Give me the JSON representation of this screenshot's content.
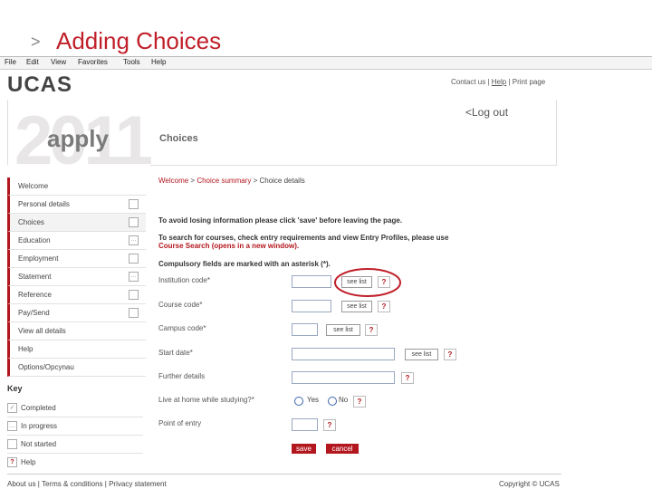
{
  "slide": {
    "arrow": ">",
    "title": "Adding Choices"
  },
  "menubar": [
    "File",
    "Edit",
    "View",
    "Favorites",
    "Tools",
    "Help"
  ],
  "header": {
    "logo": "UCAS",
    "toplinks": {
      "contact": "Contact us",
      "sep1": " | ",
      "help": "Help",
      "sep2": " | ",
      "print": "Print page"
    },
    "year": "2011",
    "apply": "apply",
    "section": "Choices",
    "logout": "<Log out"
  },
  "nav": [
    {
      "label": "Welcome",
      "check": ""
    },
    {
      "label": "Personal details",
      "check": "box"
    },
    {
      "label": "Choices",
      "check": "box"
    },
    {
      "label": "Education",
      "check": "dots"
    },
    {
      "label": "Employment",
      "check": "box"
    },
    {
      "label": "Statement",
      "check": "dots"
    },
    {
      "label": "Reference",
      "check": "box"
    },
    {
      "label": "Pay/Send",
      "check": "box"
    },
    {
      "label": "View all details",
      "check": ""
    },
    {
      "label": "Help",
      "check": ""
    },
    {
      "label": "Options/Opcynau",
      "check": ""
    }
  ],
  "key": {
    "title": "Key",
    "items": [
      {
        "label": "Completed",
        "mark": "✓"
      },
      {
        "label": "In progress",
        "mark": "…"
      },
      {
        "label": "Not started",
        "mark": ""
      },
      {
        "label": "Help",
        "mark": "?"
      }
    ]
  },
  "breadcrumb": {
    "welcome": "Welcome",
    "sep1": " > ",
    "summary": "Choice summary",
    "sep2": " > ",
    "current": "Choice details"
  },
  "info": {
    "line1": "To avoid losing information please click 'save' before leaving the page.",
    "line2": "To search for courses, check entry requirements and view Entry Profiles, please use",
    "line3": "Course Search (opens in a new window).",
    "line4": "Compulsory fields are marked with an asterisk (*)."
  },
  "form": {
    "institution": {
      "label": "Institution code*",
      "btn": "see list"
    },
    "course": {
      "label": "Course code*",
      "btn": "see list"
    },
    "campus": {
      "label": "Campus code*",
      "btn": "see list"
    },
    "start": {
      "label": "Start date*",
      "btn": "see list"
    },
    "further": {
      "label": "Further details"
    },
    "live": {
      "label": "Live at home while studying?*",
      "yes": "Yes",
      "no": "No"
    },
    "point": {
      "label": "Point of entry"
    },
    "help_mark": "?",
    "save": "save",
    "cancel": "cancel"
  },
  "footer": {
    "about": "About us",
    "sep1": " | ",
    "terms": "Terms & conditions",
    "sep2": " | ",
    "privacy": "Privacy statement",
    "copyright": "Copyright © UCAS"
  },
  "colors": {
    "accent": "#b3171e",
    "annotation": "#c0202a"
  }
}
